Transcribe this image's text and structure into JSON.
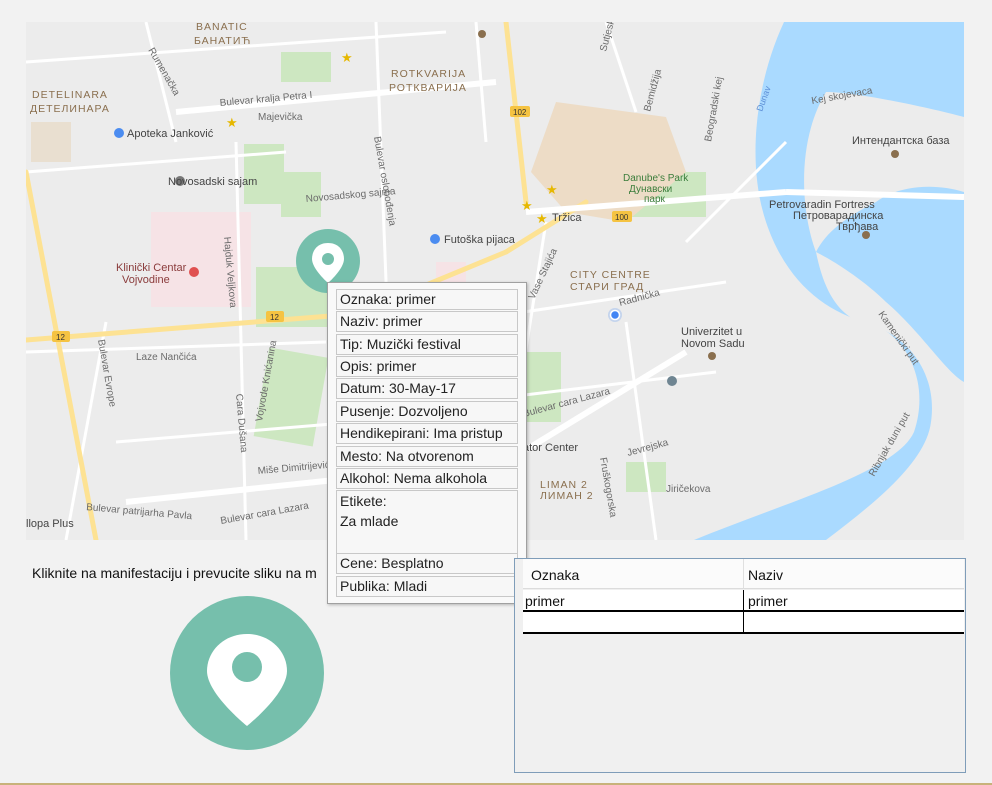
{
  "map": {
    "districts": [
      "BANATIĆ",
      "БАНАТИЋ",
      "ROTKVARIJA",
      "РОТКВАРИЈА",
      "DETELINARA",
      "ДЕТЕЛИНАРА",
      "CITY CENTRE",
      "СТАРИ ГРАД",
      "LIMAN 2",
      "ЛИМАН 2"
    ],
    "places": [
      "Apoteka Janković",
      "Novosadski sajam",
      "Klinički Centar",
      "Vojvodine",
      "Futoška pijaca",
      "Tržica",
      "Danube's Park",
      "Дунавски",
      "парк",
      "Petrovaradin Fortress",
      "Петроварадинска",
      "Тврђава",
      "Интендантска база",
      "Univerzitet u",
      "Novom Sadu",
      "ator Center",
      "llopa Plus",
      "Dunav"
    ],
    "streets": [
      "Rumenačka",
      "Bulevar kralja Petra I",
      "Majevička",
      "Bulevar oslobođenja",
      "Novosadskog sajma",
      "Hajduk Veljkova",
      "Bulevar Evrope",
      "Laze Nančića",
      "Vojvode Knićanina",
      "Cara Dušana",
      "Miše Dimitrijevića",
      "Bulevar cara Lazara",
      "Bulevar patrijarha Pavla",
      "Radnička",
      "Jevrejska",
      "Vase Stajića",
      "Fruškogorska",
      "Jiričekova",
      "Beogradski kej",
      "Kej skojevaca",
      "Kamenički put",
      "Ribnjak duni put",
      "Bulevar cara Lazara",
      "Sutjeska",
      "Bemidžija"
    ],
    "route_badges": [
      "102",
      "100",
      "12",
      "12"
    ]
  },
  "popup": {
    "oznaka": "Oznaka: primer",
    "naziv": "Naziv: primer",
    "tip": "Tip: Muzički festival",
    "opis": "Opis: primer",
    "datum": "Datum: 30-May-17",
    "pusenje": "Pusenje: Dozvoljeno",
    "hendikep": "Hendikepirani: Ima pristup",
    "mesto": "Mesto: Na otvorenom",
    "alkohol": "Alkohol: Nema alkohola",
    "etikete": "Etikete:\nZa mlade",
    "cene": "Cene: Besplatno",
    "publika": "Publika: Mladi"
  },
  "instruction": "Kliknite na manifestaciju i prevucite sliku na m",
  "table": {
    "columns": [
      "Oznaka",
      "Naziv"
    ],
    "rows": [
      [
        "primer",
        "primer"
      ],
      [
        "",
        ""
      ]
    ]
  },
  "colors": {
    "marker": "#76bfac",
    "water": "#aadaff",
    "road_major": "#fde293"
  }
}
